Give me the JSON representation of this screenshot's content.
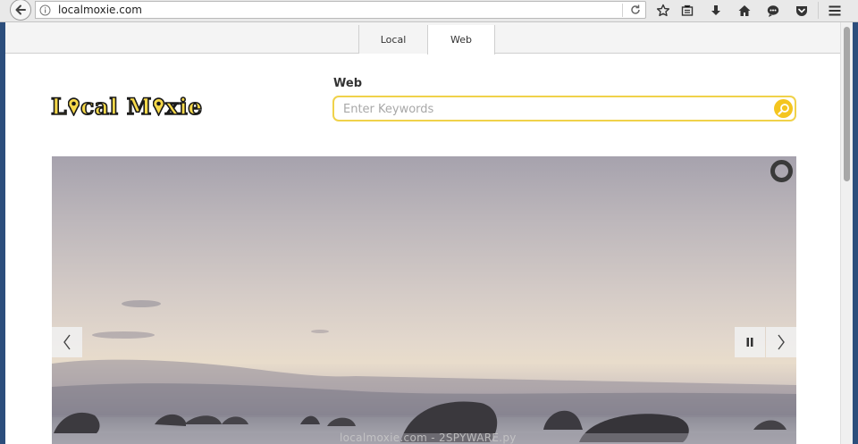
{
  "browser": {
    "url": "localmoxie.com",
    "icons": [
      "back-arrow-icon",
      "info-icon",
      "reload-icon",
      "star-icon",
      "reading-list-icon",
      "download-icon",
      "home-icon",
      "chat-icon",
      "pocket-icon",
      "hamburger-menu-icon"
    ]
  },
  "site": {
    "tabs": [
      {
        "label": "Local"
      },
      {
        "label": "Web"
      }
    ],
    "logo_text": "Local Moxie",
    "search": {
      "label": "Web",
      "placeholder": "Enter Keywords"
    },
    "colors": {
      "accent": "#f4c51f",
      "search_border": "#f0d24a",
      "logo_fill": "#f7d94a"
    }
  },
  "slider": {
    "controls": [
      "prev-arrow",
      "pause",
      "next-arrow",
      "loading-ring"
    ]
  },
  "footer_watermark": "localmoxie.com - 2SPYWARE.py"
}
